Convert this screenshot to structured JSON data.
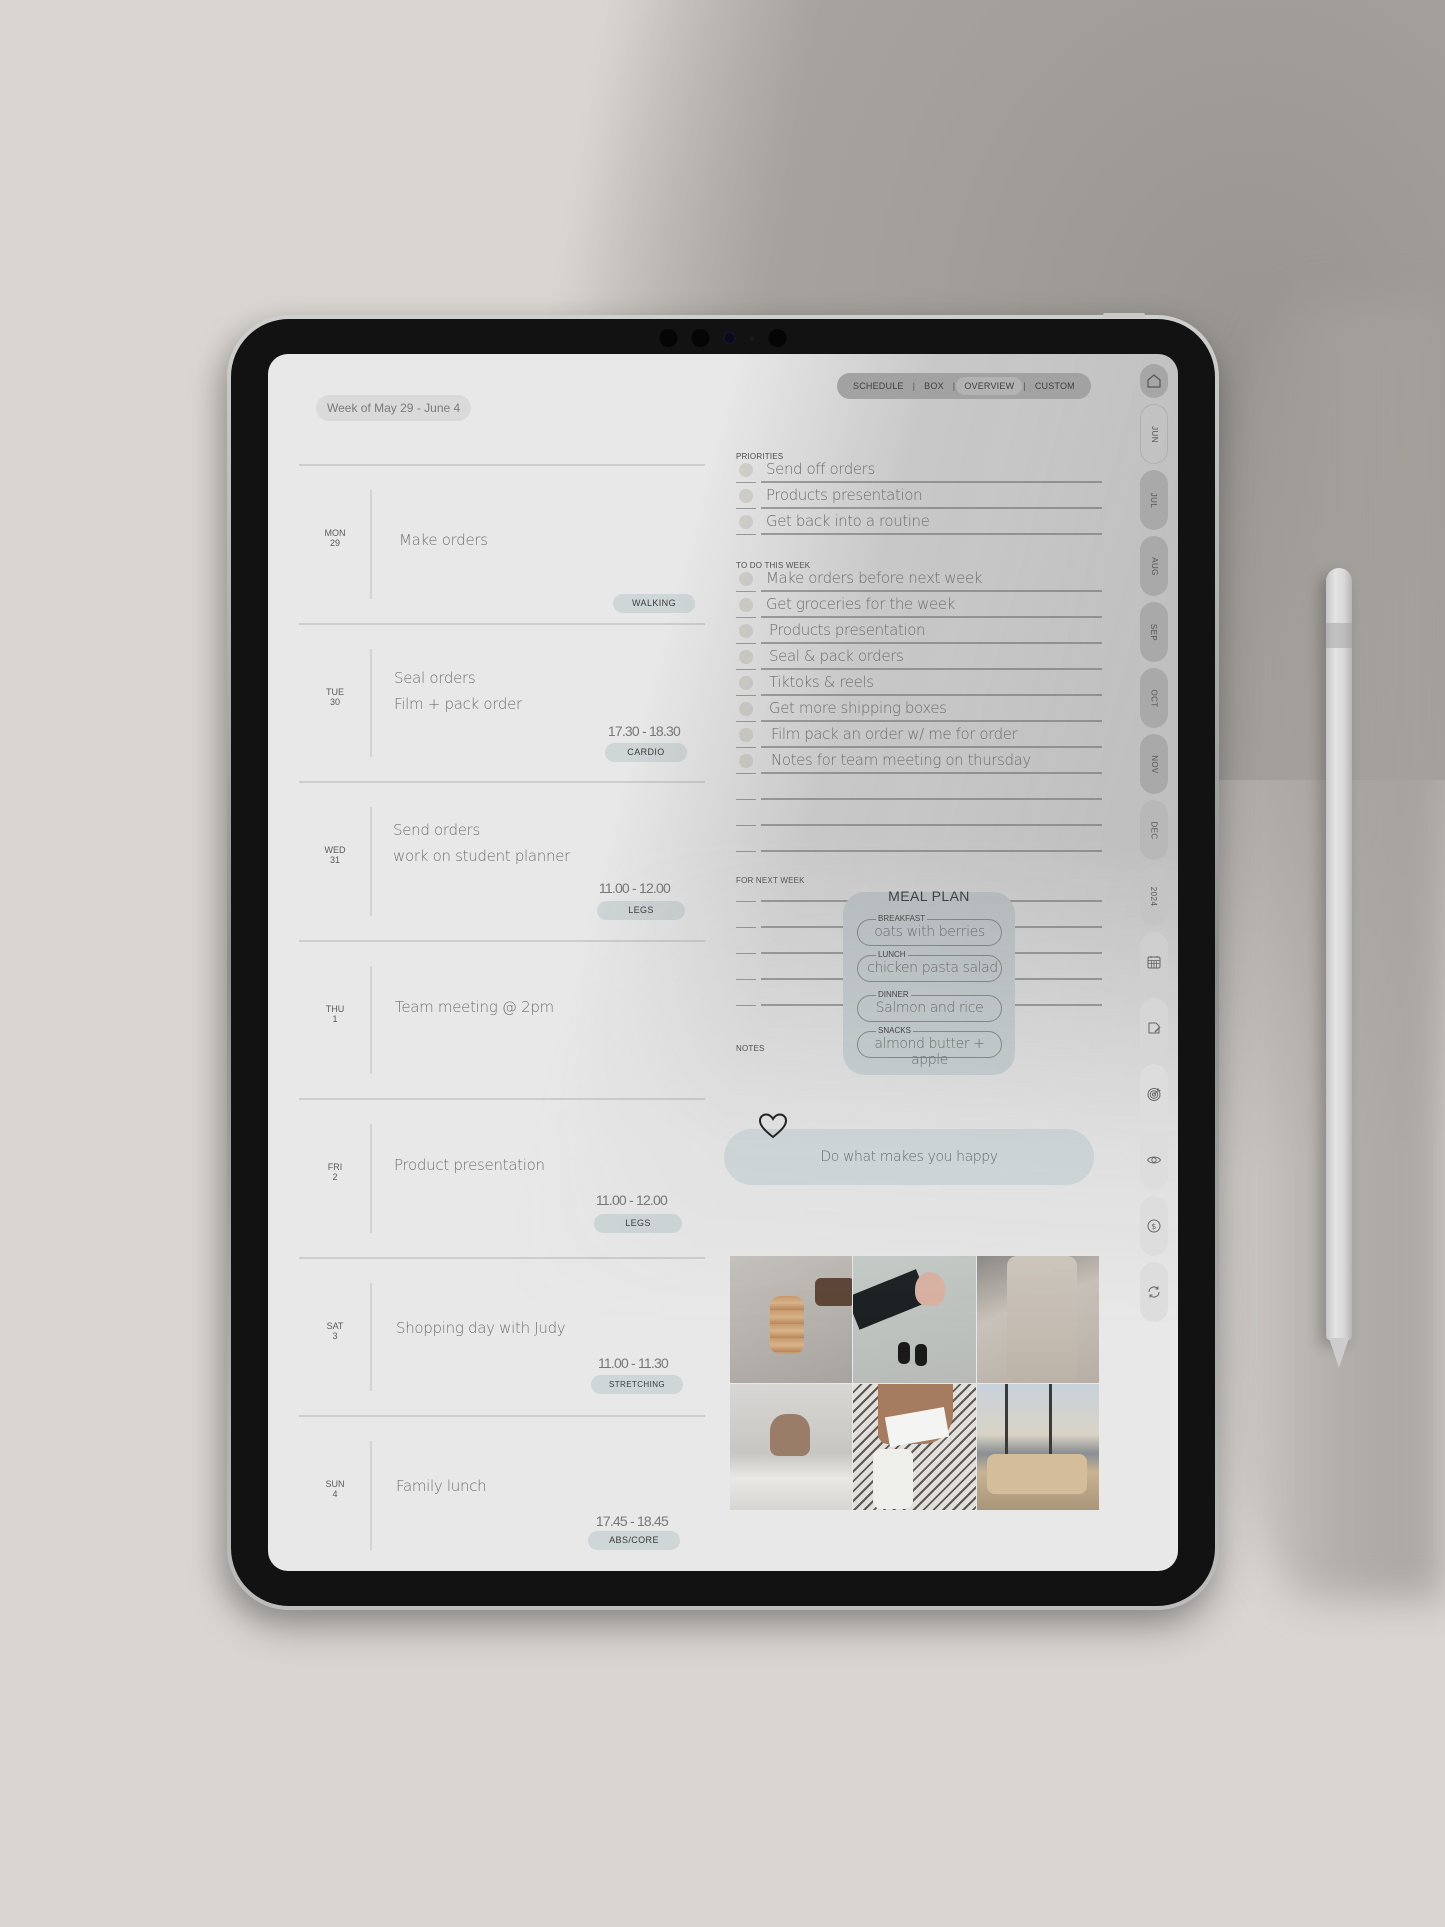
{
  "header": {
    "week_label": "Week of May 29 - June 4"
  },
  "nav": {
    "tabs": [
      {
        "label": "SCHEDULE",
        "active": false
      },
      {
        "label": "BOX",
        "active": false
      },
      {
        "label": "OVERVIEW",
        "active": true
      },
      {
        "label": "CUSTOM",
        "active": false
      }
    ],
    "separator": "|"
  },
  "days": [
    {
      "day": "MON",
      "date": "29",
      "tasks": [
        "Make orders"
      ],
      "time": "",
      "tag": "WALKING"
    },
    {
      "day": "TUE",
      "date": "30",
      "tasks": [
        "Seal orders",
        "Film + pack order"
      ],
      "time": "17.30 -  18.30",
      "tag": "CARDIO"
    },
    {
      "day": "WED",
      "date": "31",
      "tasks": [
        "Send orders",
        "work on student planner"
      ],
      "time": "11.00 - 12.00",
      "tag": "LEGS"
    },
    {
      "day": "THU",
      "date": "1",
      "tasks": [
        "Team meeting  @ 2pm"
      ],
      "time": "",
      "tag": ""
    },
    {
      "day": "FRI",
      "date": "2",
      "tasks": [
        "Product presentation"
      ],
      "time": "11.00 - 12.00",
      "tag": "LEGS"
    },
    {
      "day": "SAT",
      "date": "3",
      "tasks": [
        "Shopping day with Judy"
      ],
      "time": "11.00 -  11.30",
      "tag": "STRETCHING"
    },
    {
      "day": "SUN",
      "date": "4",
      "tasks": [
        "Family lunch"
      ],
      "time": "17.45 -  18.45",
      "tag": "ABS/CORE"
    }
  ],
  "priorities": {
    "title": "PRIORITIES",
    "items": [
      "Send off orders",
      "Products presentation",
      "Get back into a routine"
    ]
  },
  "todo": {
    "title": "TO DO THIS WEEK",
    "items": [
      "Make orders before next week",
      "Get groceries for the week",
      "Products presentation",
      "Seal & pack orders",
      "Tiktoks & reels",
      "Get more shipping boxes",
      "Film pack an order w/ me for order",
      "Notes for team meeting on thursday"
    ]
  },
  "next_week": {
    "title": "FOR NEXT WEEK"
  },
  "meal_plan": {
    "title": "MEAL PLAN",
    "items": [
      {
        "label": "BREAKFAST",
        "value": "oats with berries"
      },
      {
        "label": "LUNCH",
        "value": "chicken pasta salad"
      },
      {
        "label": "DINNER",
        "value": "Salmon and rice"
      },
      {
        "label": "SNACKS",
        "value": "almond butter + apple"
      }
    ]
  },
  "notes": {
    "title": "NOTES",
    "quote": "Do what makes you happy"
  },
  "photos": [
    {
      "subject": "iced coffee in ribbed glass with bag"
    },
    {
      "subject": "hand with rings and loafers"
    },
    {
      "subject": "knit sweater dress"
    },
    {
      "subject": "couple in white bed"
    },
    {
      "subject": "white top and pants outfit"
    },
    {
      "subject": "bedroom with city view"
    }
  ],
  "sidebar": {
    "tabs": [
      {
        "type": "icon",
        "icon": "home-icon"
      },
      {
        "type": "text",
        "label": "JUN",
        "active": true
      },
      {
        "type": "text",
        "label": "JUL"
      },
      {
        "type": "text",
        "label": "AUG"
      },
      {
        "type": "text",
        "label": "SEP"
      },
      {
        "type": "text",
        "label": "OCT"
      },
      {
        "type": "text",
        "label": "NOV"
      },
      {
        "type": "text",
        "label": "DEC"
      },
      {
        "type": "text",
        "label": "2024"
      },
      {
        "type": "icon",
        "icon": "calendar-icon"
      },
      {
        "type": "icon",
        "icon": "note-edit-icon"
      },
      {
        "type": "icon",
        "icon": "target-icon"
      },
      {
        "type": "icon",
        "icon": "eye-icon"
      },
      {
        "type": "icon",
        "icon": "dollar-icon"
      },
      {
        "type": "icon",
        "icon": "refresh-icon"
      }
    ]
  },
  "colors": {
    "screen_bg": "#e8e8e8",
    "tag_bg": "#cfd6d8",
    "meal_bg": "#cdd5d8",
    "quote_bg": "#d2dadd",
    "checkbox": "#d4d2cc",
    "surface": "#d9d5d1"
  }
}
